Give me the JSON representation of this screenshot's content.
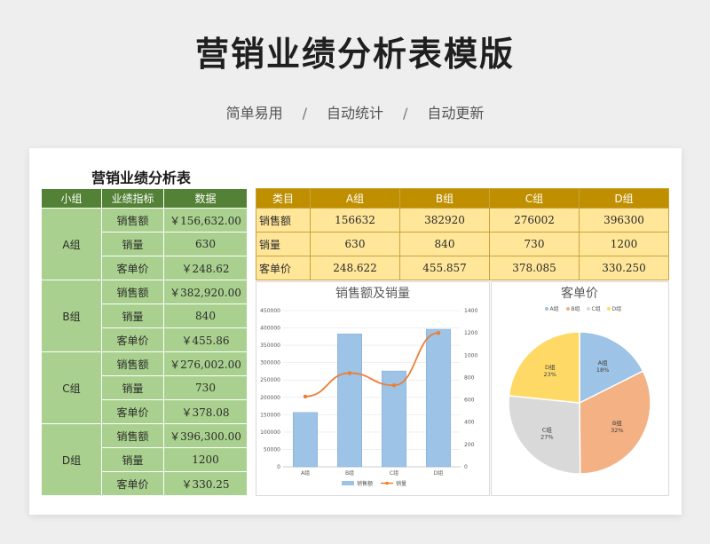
{
  "header": {
    "title": "营销业绩分析表模版",
    "tags": [
      "简单易用",
      "自动统计",
      "自动更新"
    ],
    "separator": "/"
  },
  "sheet": {
    "title": "营销业绩分析表",
    "left_table": {
      "headers": [
        "小组",
        "业绩指标",
        "数据"
      ],
      "groups": [
        {
          "name": "A组",
          "rows": [
            [
              "销售额",
              "￥156,632.00"
            ],
            [
              "销量",
              "630"
            ],
            [
              "客单价",
              "￥248.62"
            ]
          ]
        },
        {
          "name": "B组",
          "rows": [
            [
              "销售额",
              "￥382,920.00"
            ],
            [
              "销量",
              "840"
            ],
            [
              "客单价",
              "￥455.86"
            ]
          ]
        },
        {
          "name": "C组",
          "rows": [
            [
              "销售额",
              "￥276,002.00"
            ],
            [
              "销量",
              "730"
            ],
            [
              "客单价",
              "￥378.08"
            ]
          ]
        },
        {
          "name": "D组",
          "rows": [
            [
              "销售额",
              "￥396,300.00"
            ],
            [
              "销量",
              "1200"
            ],
            [
              "客单价",
              "￥330.25"
            ]
          ]
        }
      ]
    },
    "right_table": {
      "headers": [
        "类目",
        "A组",
        "B组",
        "C组",
        "D组"
      ],
      "rows": [
        [
          "销售额",
          "156632",
          "382920",
          "276002",
          "396300"
        ],
        [
          "销量",
          "630",
          "840",
          "730",
          "1200"
        ],
        [
          "客单价",
          "248.622",
          "455.857",
          "378.085",
          "330.250"
        ]
      ]
    }
  },
  "colors": {
    "bar": "#9dc3e6",
    "line": "#ed7d31",
    "pie": [
      "#9dc3e6",
      "#f4b183",
      "#d9d9d9",
      "#ffd966"
    ]
  },
  "chart_data": [
    {
      "type": "bar",
      "title": "销售额及销量",
      "categories": [
        "A组",
        "B组",
        "C组",
        "D组"
      ],
      "series": [
        {
          "name": "销售额",
          "type": "bar",
          "values": [
            156632,
            382920,
            276002,
            396300
          ]
        },
        {
          "name": "销量",
          "type": "line",
          "values": [
            630,
            840,
            730,
            1200
          ]
        }
      ],
      "y_ticks": [
        "0",
        "50000",
        "100000",
        "150000",
        "200000",
        "250000",
        "300000",
        "350000",
        "400000",
        "450000"
      ],
      "y2_ticks": [
        "0",
        "200",
        "400",
        "600",
        "800",
        "1000",
        "1200",
        "1400"
      ],
      "ylim": [
        0,
        450000
      ],
      "y2lim": [
        0,
        1400
      ],
      "legend": "bottom"
    },
    {
      "type": "pie",
      "title": "客单价",
      "categories": [
        "A组",
        "B组",
        "C组",
        "D组"
      ],
      "values": [
        248.622,
        455.857,
        378.085,
        330.25
      ],
      "percent_labels": [
        "18%",
        "32%",
        "27%",
        "23%"
      ],
      "legend": "top"
    }
  ]
}
